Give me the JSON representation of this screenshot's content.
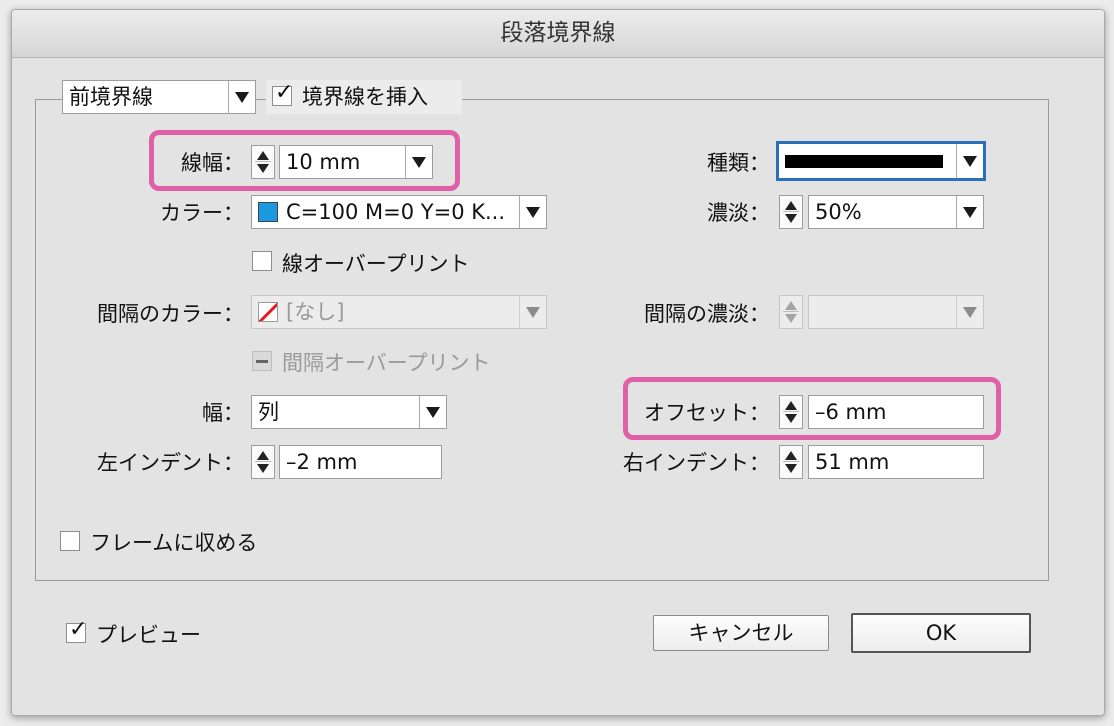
{
  "window": {
    "title": "段落境界線"
  },
  "rule_position": {
    "selected": "前境界線"
  },
  "rule_on": {
    "label": "境界線を挿入",
    "checked": true
  },
  "weight": {
    "label": "線幅：",
    "value": "10 mm"
  },
  "type": {
    "label": "種類："
  },
  "color": {
    "label": "カラー：",
    "value": "C=100 M=0 Y=0 K...",
    "swatch": "#1a98e0"
  },
  "tint": {
    "label": "濃淡：",
    "value": "50%"
  },
  "overprint_stroke": {
    "label": "線オーバープリント",
    "checked": false
  },
  "gap_color": {
    "label": "間隔のカラー：",
    "value": "[なし]"
  },
  "gap_tint": {
    "label": "間隔の濃淡："
  },
  "overprint_gap": {
    "label": "間隔オーバープリント"
  },
  "width": {
    "label": "幅：",
    "value": "列"
  },
  "offset": {
    "label": "オフセット：",
    "value": "–6 mm"
  },
  "left_indent": {
    "label": "左インデント：",
    "value": "–2 mm"
  },
  "right_indent": {
    "label": "右インデント：",
    "value": "51 mm"
  },
  "keep_in_frame": {
    "label": "フレームに収める",
    "checked": false
  },
  "preview": {
    "label": "プレビュー",
    "checked": true
  },
  "buttons": {
    "cancel": "キャンセル",
    "ok": "OK"
  },
  "colors": {
    "highlight": "#e060a8",
    "focus": "#2a6fb8"
  }
}
